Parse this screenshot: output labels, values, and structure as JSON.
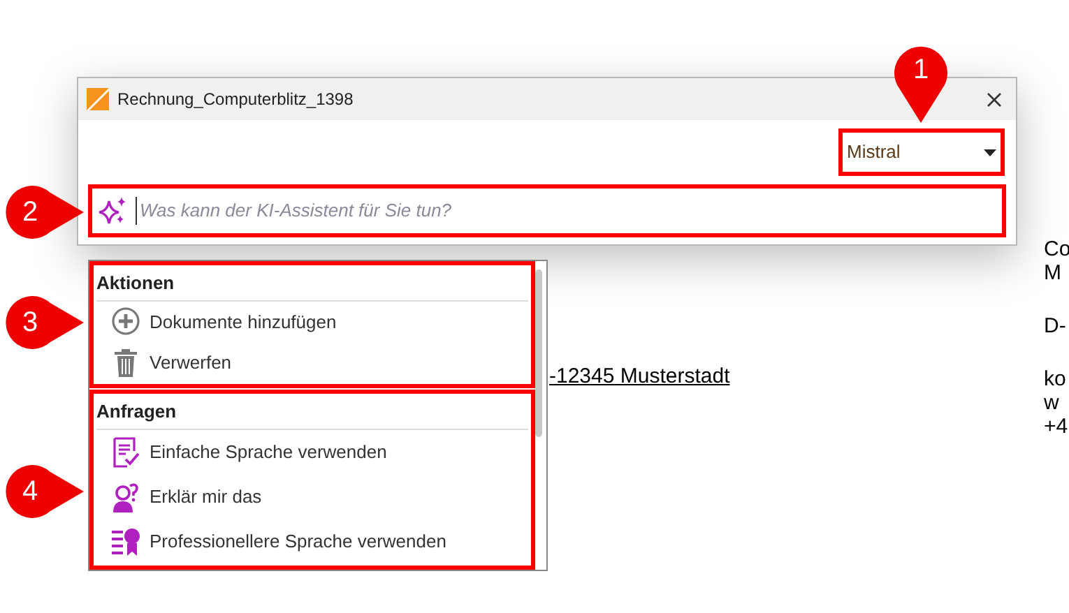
{
  "document_text": [
    {
      "kind": "address",
      "text": "-12345 Musterstadt"
    },
    {
      "kind": "side",
      "text": "Co"
    },
    {
      "kind": "side",
      "text": "M"
    },
    {
      "kind": "gap"
    },
    {
      "kind": "side",
      "text": "D-"
    },
    {
      "kind": "gap"
    },
    {
      "kind": "side",
      "text": "ko"
    },
    {
      "kind": "side",
      "text": "w"
    },
    {
      "kind": "side",
      "text": "+4"
    }
  ],
  "dialog": {
    "title": "Rechnung_Computerblitz_1398",
    "model_select": {
      "value": "Mistral"
    },
    "prompt": {
      "placeholder": "Was kann der KI-Assistent für Sie tun?"
    }
  },
  "menu": {
    "sections": [
      {
        "heading": "Aktionen",
        "items": [
          {
            "kind": "add",
            "label": "Dokumente hinzufügen"
          },
          {
            "kind": "trash",
            "label": "Verwerfen"
          }
        ]
      },
      {
        "heading": "Anfragen",
        "items": [
          {
            "kind": "simple",
            "label": "Einfache Sprache verwenden"
          },
          {
            "kind": "explain",
            "label": "Erklär mir das"
          },
          {
            "kind": "pro",
            "label": "Professionellere Sprache verwenden"
          }
        ]
      }
    ]
  },
  "callouts": [
    {
      "label": "1",
      "kind": "down"
    },
    {
      "label": "2",
      "kind": "right"
    },
    {
      "label": "3",
      "kind": "right"
    },
    {
      "label": "4",
      "kind": "right"
    }
  ]
}
